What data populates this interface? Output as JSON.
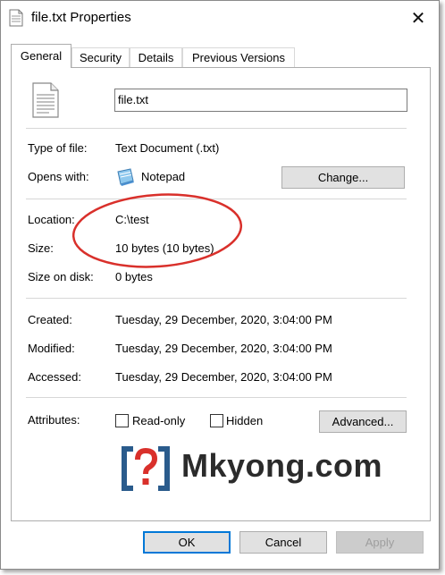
{
  "window": {
    "title": "file.txt Properties",
    "close_glyph": "✕"
  },
  "tabs": [
    {
      "label": "General",
      "active": true
    },
    {
      "label": "Security"
    },
    {
      "label": "Details"
    },
    {
      "label": "Previous Versions"
    }
  ],
  "general": {
    "file_name": "file.txt",
    "type_label": "Type of file:",
    "type_value": "Text Document (.txt)",
    "opens_label": "Opens with:",
    "opens_value": "Notepad",
    "change_button": "Change...",
    "location_label": "Location:",
    "location_value": "C:\\test",
    "size_label": "Size:",
    "size_value": "10 bytes (10 bytes)",
    "disk_label": "Size on disk:",
    "disk_value": "0 bytes",
    "created_label": "Created:",
    "created_value": "Tuesday, 29 December, 2020, 3:04:00 PM",
    "modified_label": "Modified:",
    "modified_value": "Tuesday, 29 December, 2020, 3:04:00 PM",
    "accessed_label": "Accessed:",
    "accessed_value": "Tuesday, 29 December, 2020, 3:04:00 PM",
    "attributes_label": "Attributes:",
    "readonly_label": "Read-only",
    "hidden_label": "Hidden",
    "advanced_button": "Advanced..."
  },
  "watermark": {
    "text": "Mkyong.com",
    "icon": "question-code-icon"
  },
  "footer": {
    "ok": "OK",
    "cancel": "Cancel",
    "apply": "Apply"
  },
  "colors": {
    "focus_blue": "#0078d7",
    "annotation_red": "#d9302b",
    "watermark_red": "#d9302b",
    "watermark_blue": "#2a5b8c"
  }
}
